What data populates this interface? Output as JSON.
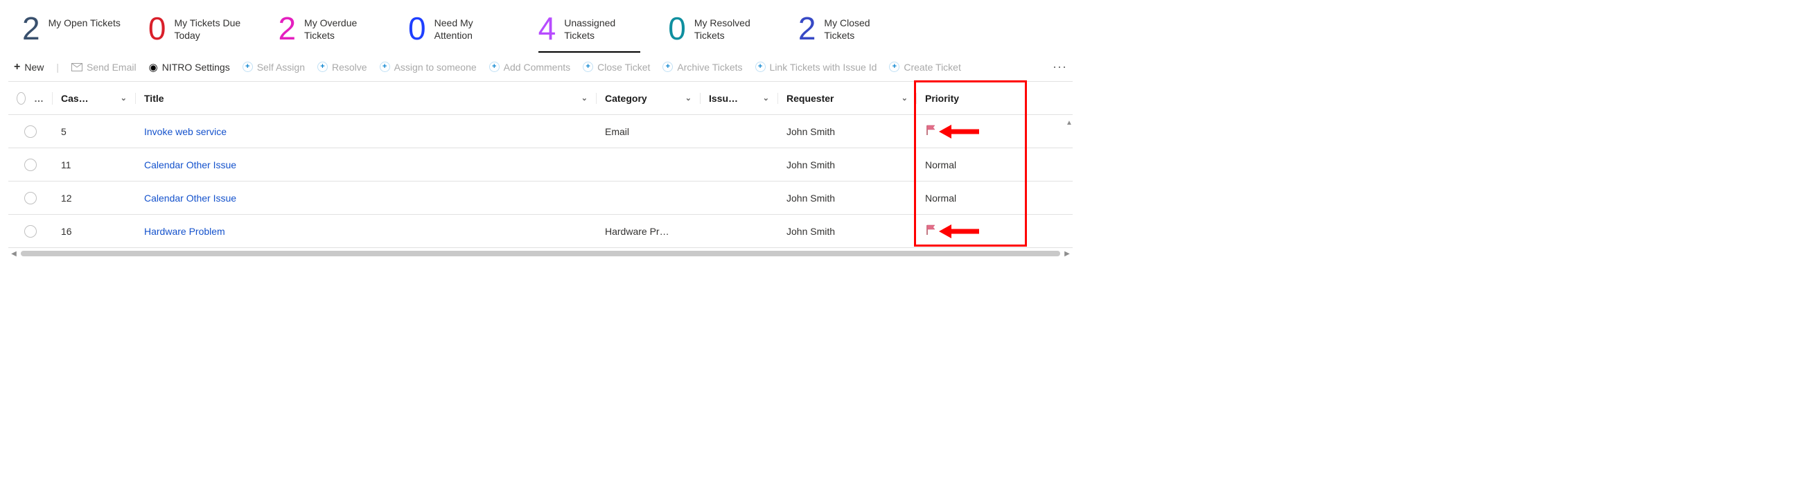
{
  "stats": [
    {
      "count": "2",
      "label": "My Open Tickets"
    },
    {
      "count": "0",
      "label": "My Tickets Due Today"
    },
    {
      "count": "2",
      "label": "My Overdue Tickets"
    },
    {
      "count": "0",
      "label": "Need My Attention"
    },
    {
      "count": "4",
      "label": "Unassigned Tickets"
    },
    {
      "count": "0",
      "label": "My Resolved Tickets"
    },
    {
      "count": "2",
      "label": "My Closed Tickets"
    }
  ],
  "toolbar": {
    "new": "New",
    "send_email": "Send Email",
    "nitro": "NITRO Settings",
    "self_assign": "Self Assign",
    "resolve": "Resolve",
    "assign": "Assign to someone",
    "add_comments": "Add Comments",
    "close_ticket": "Close Ticket",
    "archive": "Archive Tickets",
    "link": "Link Tickets with Issue Id",
    "create": "Create Ticket",
    "more": "···"
  },
  "columns": {
    "case": "Cas…",
    "title": "Title",
    "category": "Category",
    "issue": "Issu…",
    "requester": "Requester",
    "priority": "Priority",
    "ell": "…"
  },
  "rows": [
    {
      "case": "5",
      "title": "Invoke web service",
      "category": "Email",
      "issue": "",
      "requester": "John Smith",
      "priority": "flag"
    },
    {
      "case": "11",
      "title": "Calendar Other Issue",
      "category": "",
      "issue": "",
      "requester": "John Smith",
      "priority": "Normal"
    },
    {
      "case": "12",
      "title": "Calendar Other Issue",
      "category": "",
      "issue": "",
      "requester": "John Smith",
      "priority": "Normal"
    },
    {
      "case": "16",
      "title": "Hardware Problem",
      "category": "Hardware Pr…",
      "issue": "",
      "requester": "John Smith",
      "priority": "flag"
    }
  ],
  "annotations": {
    "arrow_rows": [
      0,
      3
    ]
  }
}
